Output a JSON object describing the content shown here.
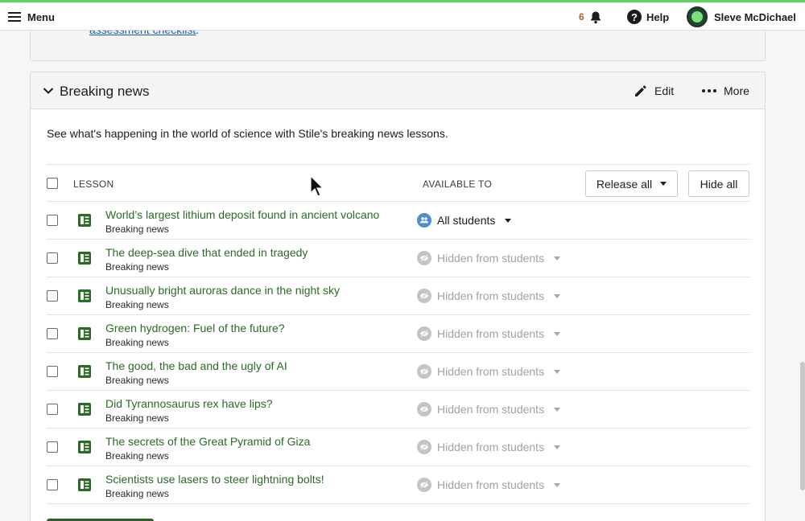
{
  "topbar": {
    "menu_label": "Menu",
    "notification_count": "6",
    "help_label": "Help",
    "user_name": "Sleve McDichael"
  },
  "previous_card": {
    "link_text": "assessment checklist",
    "trailing": "."
  },
  "section": {
    "title": "Breaking news",
    "edit_label": "Edit",
    "more_label": "More",
    "description": "See what's happening in the world of science with Stile's breaking news lessons."
  },
  "table": {
    "col_lesson": "LESSON",
    "col_available": "AVAILABLE TO",
    "release_all_label": "Release all",
    "hide_all_label": "Hide all",
    "rows": [
      {
        "title": "World’s largest lithium deposit found in ancient volcano",
        "subtitle": "Breaking news",
        "availability": "All students"
      },
      {
        "title": "The deep-sea dive that ended in tragedy",
        "subtitle": "Breaking news",
        "availability": "Hidden from students"
      },
      {
        "title": "Unusually bright auroras dance in the night sky",
        "subtitle": "Breaking news",
        "availability": "Hidden from students"
      },
      {
        "title": "Green hydrogen: Fuel of the future?",
        "subtitle": "Breaking news",
        "availability": "Hidden from students"
      },
      {
        "title": "The good, the bad and the ugly of AI",
        "subtitle": "Breaking news",
        "availability": "Hidden from students"
      },
      {
        "title": "Did Tyrannosaurus rex have lips?",
        "subtitle": "Breaking news",
        "availability": "Hidden from students"
      },
      {
        "title": "The secrets of the Great Pyramid of Giza",
        "subtitle": "Breaking news",
        "availability": "Hidden from students"
      },
      {
        "title": "Scientists use lasers to steer lightning bolts!",
        "subtitle": "Breaking news",
        "availability": "Hidden from students"
      }
    ]
  },
  "colors": {
    "accent_top": "#5dd35a",
    "lesson_link": "#2b6b26",
    "all_students_icon": "#4a8fd4",
    "hidden_text": "#a2a2a2",
    "notification": "#b8621b"
  }
}
